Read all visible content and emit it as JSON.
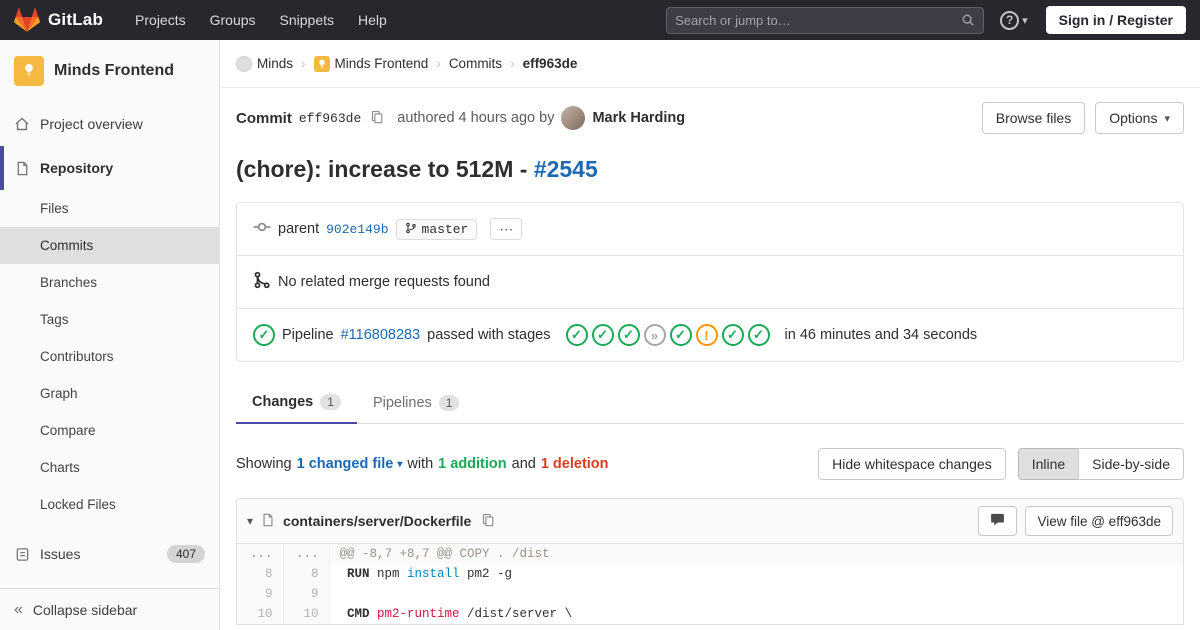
{
  "navbar": {
    "brand": "GitLab",
    "menu": [
      "Projects",
      "Groups",
      "Snippets",
      "Help"
    ],
    "search_placeholder": "Search or jump to…",
    "sign_in_label": "Sign in / Register"
  },
  "icons": {
    "chevron_down": "▾",
    "collapse": "«",
    "question": "?",
    "ellipsis": "⋯"
  },
  "sidebar": {
    "project_name": "Minds Frontend",
    "overview_label": "Project overview",
    "repository_label": "Repository",
    "repo_submenu": [
      "Files",
      "Commits",
      "Branches",
      "Tags",
      "Contributors",
      "Graph",
      "Compare",
      "Charts",
      "Locked Files"
    ],
    "active_item": "Commits",
    "issues_label": "Issues",
    "issues_count": "407",
    "collapse_label": "Collapse sidebar"
  },
  "breadcrumb": {
    "separator": "›",
    "items": [
      {
        "label": "Minds",
        "icon": "group-avatar"
      },
      {
        "label": "Minds Frontend",
        "icon": "bulb-avatar"
      },
      {
        "label": "Commits"
      },
      {
        "label": "eff963de",
        "current": true
      }
    ]
  },
  "commit": {
    "label": "Commit",
    "sha": "eff963de",
    "authored_text": "authored 4 hours ago by",
    "author": "Mark Harding",
    "browse_files_label": "Browse files",
    "options_label": "Options",
    "title": "(chore): increase to 512M - ",
    "title_link": "#2545",
    "parent_label": "parent",
    "parent_sha": "902e149b",
    "branch_name": "master",
    "related_mr_text": "No related merge requests found"
  },
  "pipeline": {
    "prefix": "Pipeline",
    "id": "#116808283",
    "status_text": "passed with stages",
    "stages": [
      "success",
      "success",
      "success",
      "skipped",
      "success",
      "warning",
      "success",
      "success"
    ],
    "duration_text": "in 46 minutes and 34 seconds"
  },
  "tabs": [
    {
      "label": "Changes",
      "count": "1"
    },
    {
      "label": "Pipelines",
      "count": "1"
    }
  ],
  "diff_bar": {
    "showing": "Showing",
    "changed_files": "1 changed file",
    "with_text": "with",
    "additions": "1 addition",
    "and_text": "and",
    "deletions": "1 deletion",
    "hide_whitespace_label": "Hide whitespace changes",
    "inline_label": "Inline",
    "side_by_side_label": "Side-by-side"
  },
  "file_diff": {
    "path": "containers/server/Dockerfile",
    "view_file_label": "View file @ eff963de",
    "rows": [
      {
        "old": "...",
        "new": "...",
        "type": "hunk",
        "segments": [
          {
            "t": "@@ -8,7 +8,7 @@ COPY . /dist",
            "c": "hunk"
          }
        ]
      },
      {
        "old": "8",
        "new": "8",
        "type": "context",
        "segments": [
          {
            "t": " RUN",
            "c": "kw"
          },
          {
            "t": " npm ",
            "c": "plain"
          },
          {
            "t": "install",
            "c": "nb"
          },
          {
            "t": " pm2 -g",
            "c": "plain"
          }
        ]
      },
      {
        "old": "9",
        "new": "9",
        "type": "context",
        "segments": []
      },
      {
        "old": "10",
        "new": "10",
        "type": "context",
        "segments": [
          {
            "t": " CMD",
            "c": "kw"
          },
          {
            "t": " ",
            "c": "plain"
          },
          {
            "t": "pm2-runtime",
            "c": "str"
          },
          {
            "t": " /dist/server \\",
            "c": "plain"
          }
        ]
      }
    ]
  },
  "colors": {
    "accent_link": "#1b69b6",
    "success": "#1aaa55",
    "warning": "#fc9403",
    "deletion": "#db3b21",
    "navbar_bg": "#28272e",
    "sidebar_active_indicator": "#4b4ba3"
  }
}
